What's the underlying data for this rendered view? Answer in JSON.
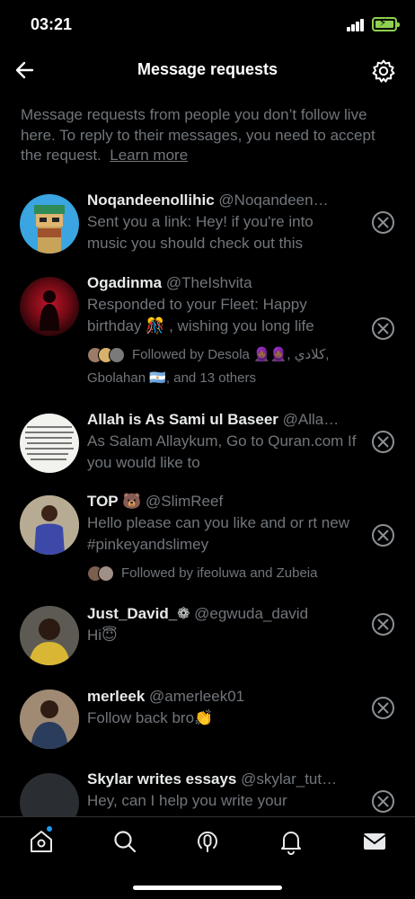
{
  "status": {
    "time": "03:21"
  },
  "header": {
    "title": "Message requests",
    "back_icon": "arrow-left-icon",
    "settings_icon": "gear-icon"
  },
  "intro": {
    "text": "Message requests from people you don’t follow live here. To reply to their messages, you need to accept the request.",
    "learn_more": "Learn more"
  },
  "requests": [
    {
      "name": "Noqandeenollihic",
      "handle": "@Noqandeen…",
      "message": "Sent you a link: Hey! if you're into music you should check out this"
    },
    {
      "name": "Ogadinma",
      "handle": "@TheIshvita",
      "message": "Responded to your Fleet: Happy birthday 🎊 , wishing you long life",
      "followed_by": "Followed by Desola 🧕🏾🧕🏾, كلادي, Gbolahan 🇦🇷, and 13 others"
    },
    {
      "name": "Allah is As Sami ul Baseer",
      "handle": "@Alla…",
      "message": "As Salam Allaykum, Go to Quran.com If you would like to"
    },
    {
      "name": "TOP 🐻",
      "handle": "@SlimReef",
      "message": "Hello please can you like and or rt new #pinkeyandslimey",
      "followed_by": "Followed by ifeoluwa and Zubeia"
    },
    {
      "name": "Just_David_❁",
      "handle": "@egwuda_david",
      "message": "Hi😇"
    },
    {
      "name": "merleek",
      "handle": "@amerleek01",
      "message": "Follow back bro👏"
    },
    {
      "name": "Skylar writes essays",
      "handle": "@skylar_tut…",
      "message": "Hey, can I help you write your"
    }
  ],
  "tabs": [
    {
      "icon": "home-icon"
    },
    {
      "icon": "search-icon"
    },
    {
      "icon": "spaces-icon"
    },
    {
      "icon": "notifications-icon"
    },
    {
      "icon": "messages-icon"
    }
  ],
  "colors": {
    "background": "#000000",
    "text": "#e7e9ea",
    "muted": "#71767b",
    "accent": "#1d9bf0",
    "battery": "#8fd14f"
  }
}
